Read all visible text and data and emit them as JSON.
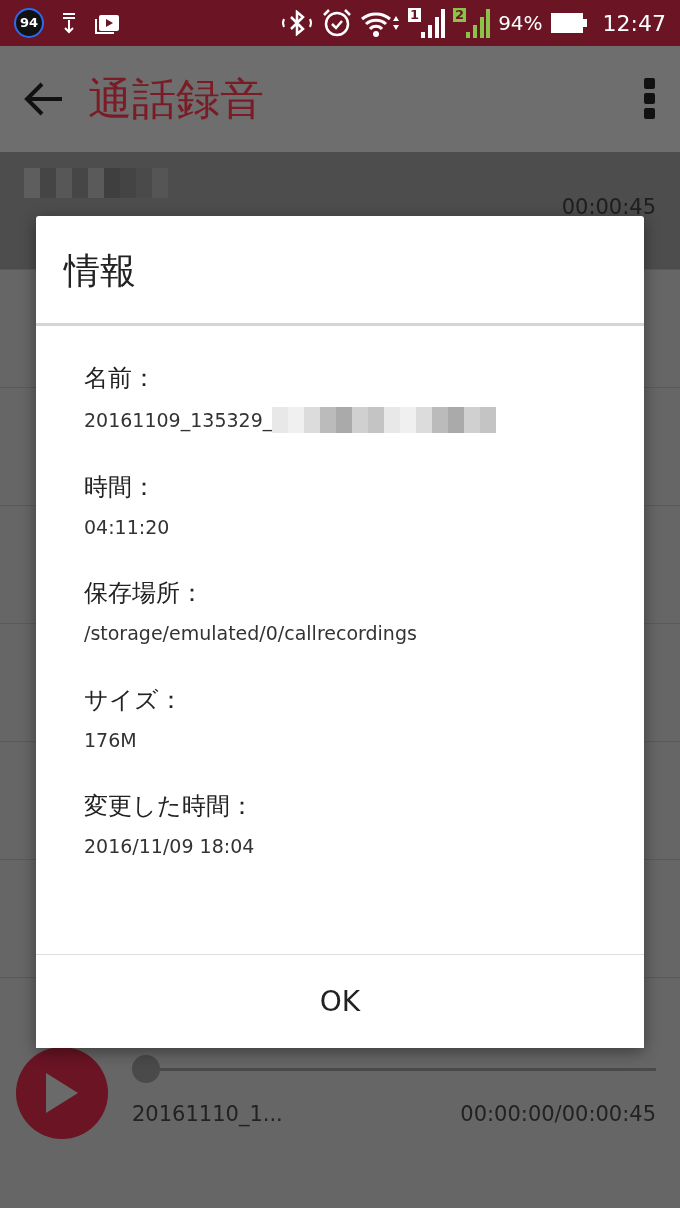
{
  "status_bar": {
    "badge": "94",
    "sim_1": "1",
    "sim_2": "2",
    "battery": "94%",
    "time": "12:47"
  },
  "app_bar": {
    "title": "通話録音"
  },
  "recordings": [
    {
      "redacted_name": true,
      "duration": "00:00:45",
      "selected": true
    }
  ],
  "dialog": {
    "title": "情報",
    "fields": [
      {
        "label": "名前：",
        "value": "20161109_135329_",
        "redacted": true
      },
      {
        "label": "時間：",
        "value": "04:11:20",
        "redacted": false
      },
      {
        "label": "保存場所：",
        "value": "/storage/emulated/0/callrecordings",
        "redacted": false
      },
      {
        "label": "サイズ：",
        "value": "176M",
        "redacted": false
      },
      {
        "label": "変更した時間：",
        "value": "2016/11/09 18:04",
        "redacted": false
      }
    ],
    "button": "OK"
  },
  "player": {
    "level": 0,
    "file_name": "20161110_1...",
    "time": "00:00:00/00:00:45"
  }
}
